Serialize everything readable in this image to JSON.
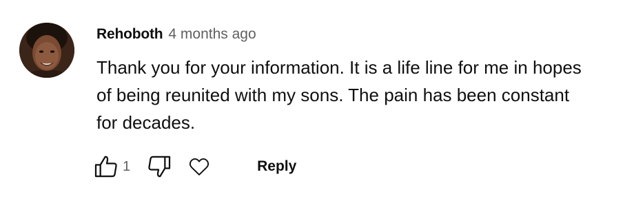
{
  "comment": {
    "author": "Rehoboth",
    "timestamp": "4 months ago",
    "text": "Thank you for your information. It is a life line for me in hopes of being reunited with my sons. The pain has been constant for decades.",
    "avatar": "author-avatar-photo"
  },
  "actions": {
    "like_icon": "thumbs-up-icon",
    "like_count": "1",
    "dislike_icon": "thumbs-down-icon",
    "heart_icon": "heart-icon",
    "reply_label": "Reply"
  },
  "colors": {
    "text_primary": "#0f0f0f",
    "text_secondary": "#606060",
    "background": "#ffffff"
  }
}
